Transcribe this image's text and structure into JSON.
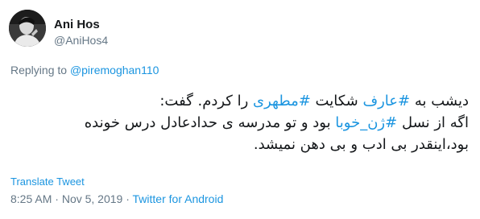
{
  "user": {
    "display_name": "Ani Hos",
    "handle": "@AniHos4"
  },
  "reply": {
    "prefix": "Replying to",
    "mention": "@piremoghan110"
  },
  "tweet": {
    "line1": {
      "t1": "دیشب به ",
      "h1": "#عارف",
      "t2": " شکایت ",
      "h2": "#مطهری",
      "t3": " را  کردم. گفت:"
    },
    "line2": {
      "t1": "اگه از نسل ",
      "h1": "#ژن_خوبا",
      "t2": " بود و تو مدرسه ی حدادعادل درس خونده"
    },
    "line3": {
      "t1": "بود،اینقدر بی ادب و بی دهن نمیشد."
    }
  },
  "translate_label": "Translate Tweet",
  "meta": {
    "time": "8:25 AM",
    "separator1": " · ",
    "date": "Nov 5, 2019",
    "separator2": " · ",
    "source": "Twitter for Android"
  },
  "colors": {
    "link": "#1b95e0",
    "muted": "#657786",
    "text": "#14171a"
  }
}
